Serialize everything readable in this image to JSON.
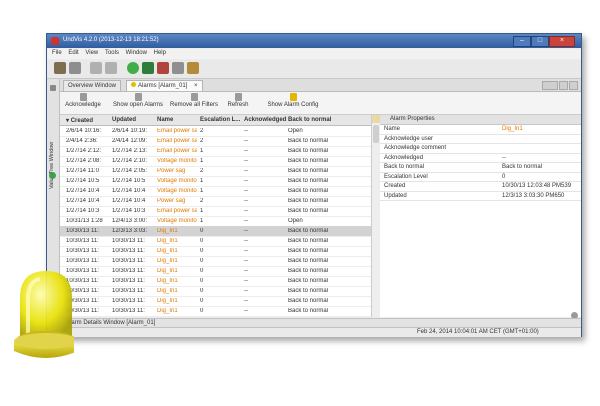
{
  "window": {
    "title": "UndVis 4.2.0 (2013-12-13 18:21:52)"
  },
  "menu": [
    "File",
    "Edit",
    "View",
    "Tools",
    "Window",
    "Help"
  ],
  "side_tab": "Value Tree Window",
  "tabs": [
    {
      "label": "Overview Window"
    },
    {
      "label": "Alarms [Alarm_01]",
      "close": "×"
    }
  ],
  "actions": [
    {
      "label": "Acknowledge"
    },
    {
      "label": "Show open Alarms"
    },
    {
      "label": "Remove all Filters"
    },
    {
      "label": "Refresh"
    },
    {
      "label": "Show Alarm Config"
    }
  ],
  "table": {
    "headers": [
      "Created",
      "Updated",
      "Name",
      "Escalation L...",
      "Acknowledged",
      "Back to normal"
    ],
    "rows": [
      [
        "2/6/14 10:16:",
        "2/6/14 10:19:",
        "Email power sag",
        "2",
        "--",
        "Open"
      ],
      [
        "2/4/14 2:36:",
        "2/4/14 12:09:",
        "Email power sag",
        "2",
        "--",
        "Back to normal"
      ],
      [
        "1/27/14 2:12:",
        "1/27/14 2:13:",
        "Email power sag",
        "1",
        "--",
        "Back to normal"
      ],
      [
        "1/27/14 2:08:",
        "1/27/14 2:10:",
        "Voltage monito...",
        "1",
        "--",
        "Back to normal"
      ],
      [
        "1/27/14 11:0",
        "1/27/14 2:05:",
        "Power sag",
        "2",
        "--",
        "Back to normal"
      ],
      [
        "1/27/14 10:5",
        "1/27/14 10:5",
        "Voltage monito...",
        "1",
        "--",
        "Back to normal"
      ],
      [
        "1/27/14 10:4",
        "1/27/14 10:4",
        "Voltage monito...",
        "1",
        "--",
        "Back to normal"
      ],
      [
        "1/27/14 10:4",
        "1/27/14 10:4",
        "Power sag",
        "2",
        "--",
        "Back to normal"
      ],
      [
        "1/27/14 10:3",
        "1/27/14 10:3",
        "Email power sag",
        "1",
        "--",
        "Back to normal"
      ],
      [
        "10/31/13 1:28",
        "12/4/13 3:00:",
        "Voltage monito...",
        "1",
        "--",
        "Open"
      ],
      [
        "10/30/13 11:",
        "12/3/13 3:03:",
        "Dig_In1",
        "0",
        "--",
        "Back to normal"
      ],
      [
        "10/30/13 11:",
        "10/30/13 11:",
        "Dig_In1",
        "0",
        "--",
        "Back to normal"
      ],
      [
        "10/30/13 11:",
        "10/30/13 11:",
        "Dig_In1",
        "0",
        "--",
        "Back to normal"
      ],
      [
        "10/30/13 11:",
        "10/30/13 11:",
        "Dig_In1",
        "0",
        "--",
        "Back to normal"
      ],
      [
        "10/30/13 11:",
        "10/30/13 11:",
        "Dig_In1",
        "0",
        "--",
        "Back to normal"
      ],
      [
        "10/30/13 11:",
        "10/30/13 11:",
        "Dig_In1",
        "0",
        "--",
        "Back to normal"
      ],
      [
        "10/30/13 11:",
        "10/30/13 11:",
        "Dig_In1",
        "0",
        "--",
        "Back to normal"
      ],
      [
        "10/30/13 11:",
        "10/30/13 11:",
        "Dig_In1",
        "0",
        "--",
        "Back to normal"
      ],
      [
        "10/30/13 11:",
        "10/30/13 11:",
        "Dig_In1",
        "0",
        "--",
        "Back to normal"
      ]
    ],
    "selected_row": 10
  },
  "properties": {
    "title": "Alarm Properties",
    "rows": [
      {
        "key": "Name",
        "value": "Dig_In1"
      },
      {
        "key": "Acknowledge user",
        "value": ""
      },
      {
        "key": "Acknowledge comment",
        "value": ""
      },
      {
        "key": "Acknowledged",
        "value": "--"
      },
      {
        "key": "Back to normal",
        "value": "Back to normal"
      },
      {
        "key": "Escalation Level",
        "value": "0"
      },
      {
        "key": "Created",
        "value": "10/30/13 12:03:48 PM539"
      },
      {
        "key": "Updated",
        "value": "12/3/13 3:03:30 PM650"
      }
    ]
  },
  "bottom_tab": "Alarm Details Window [Alarm_01]",
  "status": {
    "datetime": "Feb 24, 2014 10:04:01 AM CET (GMT+01:00)"
  },
  "colors": {
    "titlebar": "#2f5c9e",
    "alarm_name_text": "#e07a00",
    "selected_row": "#d3d3d3",
    "lamp": "#e9e20b"
  }
}
